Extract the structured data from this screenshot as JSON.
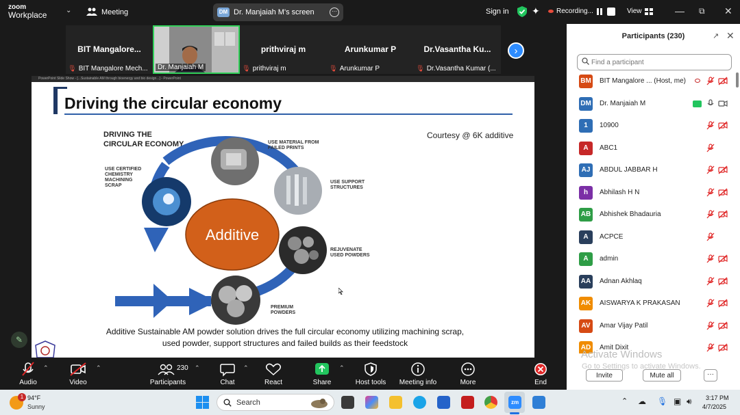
{
  "app": {
    "logo_line1": "zoom",
    "logo_line2": "Workplace"
  },
  "topbar": {
    "meeting_label": "Meeting",
    "screen_share_initials": "DM",
    "screen_share_label": "Dr. Manjaiah M's screen",
    "signin_label": "Sign in",
    "recording_label": "Recording...",
    "view_label": "View"
  },
  "video_strip": {
    "tiles": [
      {
        "big": "BIT  Mangalore...",
        "foot": "BIT Mangalore Mech...",
        "muted": true
      },
      {
        "big": "",
        "foot": "Dr. Manjaiah M",
        "muted": false,
        "active": true
      },
      {
        "big": "prithviraj m",
        "foot": "prithviraj m",
        "muted": true
      },
      {
        "big": "Arunkumar P",
        "foot": "Arunkumar P",
        "muted": true
      },
      {
        "big": "Dr.Vasantha  Ku...",
        "foot": "Dr.Vasantha Kumar (...",
        "muted": true
      }
    ]
  },
  "slide": {
    "window_title": "PowerPoint Slide Show - [...Sustainable AM through bioenergy and bio design...] - PowerPoint",
    "title": "Driving the circular economy",
    "diagram_title_line1": "DRIVING THE",
    "diagram_title_line2": "CIRCULAR ECONOMY",
    "courtesy": "Courtesy @ 6K additive",
    "center_label": "Additive",
    "labels": {
      "certified_1": "USE CERTIFIED",
      "certified_2": "CHEMISTRY",
      "certified_3": "MACHINING",
      "certified_4": "SCRAP",
      "failed_1": "USE MATERIAL FROM",
      "failed_2": "FAILED PRINTS",
      "support_1": "USE SUPPORT",
      "support_2": "STRUCTURES",
      "rejuv_1": "REJUVENATE",
      "rejuv_2": "USED POWDERS",
      "premium_1": "PREMIUM",
      "premium_2": "POWDERS"
    },
    "caption_line1": "Additive Sustainable AM powder solution drives the full circular economy utilizing machining scrap,",
    "caption_line2": "used powder, support structures and failed builds as their feedstock"
  },
  "participants_panel": {
    "title": "Participants (230)",
    "search_placeholder": "Find a participant",
    "participants": [
      {
        "initials": "BM",
        "name": "BIT Mangalore ...  (Host, me)",
        "color": "#d64a14",
        "video_off": true,
        "mic_muted": true,
        "rec": true
      },
      {
        "initials": "DM",
        "name": "Dr. Manjaiah M",
        "color": "#2f6eb5",
        "video_off": false,
        "mic_muted": false,
        "sharing": true
      },
      {
        "initials": "1",
        "name": "10900",
        "color": "#2f6eb5",
        "video_off": true,
        "mic_muted": true
      },
      {
        "initials": "A",
        "name": "ABC1",
        "color": "#c62828",
        "mic_muted": true
      },
      {
        "initials": "AJ",
        "name": "ABDUL JABBAR H",
        "color": "#2f6eb5",
        "video_off": true,
        "mic_muted": true
      },
      {
        "initials": "h",
        "name": "Abhilash H N",
        "color": "#7b2fa6",
        "video_off": true,
        "mic_muted": true
      },
      {
        "initials": "AB",
        "name": "Abhishek Bhadauria",
        "color": "#2e9d46",
        "video_off": true,
        "mic_muted": true
      },
      {
        "initials": "A",
        "name": "ACPCE",
        "color": "#2a3f5c",
        "mic_muted": true
      },
      {
        "initials": "A",
        "name": "admin",
        "color": "#2e9d46",
        "video_off": true,
        "mic_muted": true
      },
      {
        "initials": "AA",
        "name": "Adnan Akhlaq",
        "color": "#2a3f5c",
        "video_off": true,
        "mic_muted": true
      },
      {
        "initials": "AK",
        "name": "AISWARYA K PRAKASAN",
        "color": "#f08c00",
        "video_off": true,
        "mic_muted": true
      },
      {
        "initials": "AV",
        "name": "Amar Vijay Patil",
        "color": "#d64a14",
        "video_off": true,
        "mic_muted": true
      },
      {
        "initials": "AD",
        "name": "Amit Dixit",
        "color": "#f08c00",
        "video_off": true,
        "mic_muted": true
      }
    ],
    "watermark_line1": "Activate Windows",
    "watermark_line2": "Go to Settings to activate Windows.",
    "invite_label": "Invite",
    "mute_all_label": "Mute all",
    "more_label": "···"
  },
  "toolbar": {
    "audio": "Audio",
    "video": "Video",
    "participants": "Participants",
    "participants_count": "230",
    "chat": "Chat",
    "react": "React",
    "share": "Share",
    "host_tools": "Host tools",
    "meeting_info": "Meeting info",
    "more": "More",
    "end": "End"
  },
  "taskbar": {
    "weather_badge": "1",
    "temp": "94°F",
    "condition": "Sunny",
    "search_label": "Search",
    "time": "3:17 PM",
    "date": "4/7/2025"
  },
  "colors": {
    "zoom_blue": "#2d8cff",
    "active_speaker": "#32d25a",
    "mute_red": "#e74c3c",
    "share_green": "#22c55e",
    "end_red": "#e02828",
    "slide_rule": "#2e5fa8",
    "cycle_arrow": "#2f63b8",
    "additive_ellipse": "#d2601a"
  }
}
